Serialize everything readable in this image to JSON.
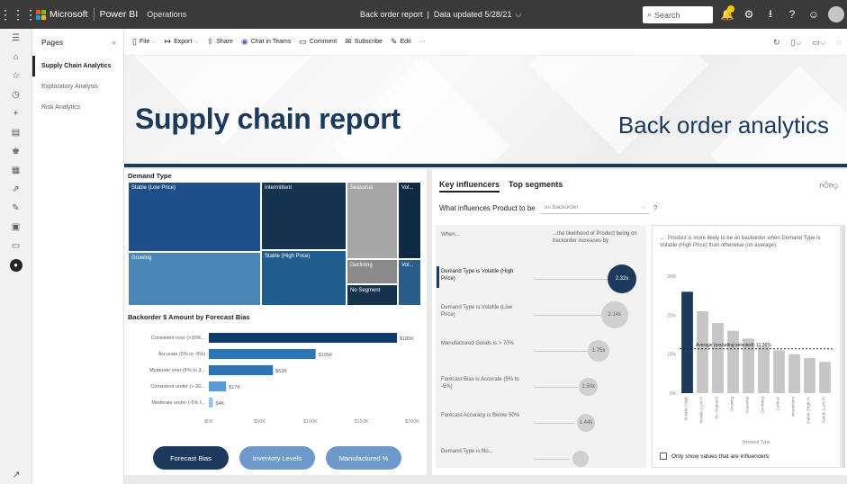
{
  "topbar": {
    "brand_ms": "Microsoft",
    "brand_pbi": "Power BI",
    "workspace": "Operations",
    "report_name": "Back order report",
    "data_updated": "Data updated 5/28/21",
    "search_placeholder": "Search",
    "icons": [
      "waffle-icon",
      "notification-icon",
      "settings-icon",
      "download-icon",
      "help-icon",
      "smiley-icon",
      "avatar"
    ],
    "colors": {
      "bar": "#3b3a39",
      "notification": "#f2c811"
    }
  },
  "rail": {
    "icons": [
      "menu-icon",
      "home-icon",
      "favorites-icon",
      "recent-icon",
      "create-icon",
      "datasets-icon",
      "goals-icon",
      "apps-icon",
      "shared-icon",
      "learn-icon",
      "workspaces-icon",
      "deployment-icon",
      "workspace-active-icon"
    ],
    "expand_glyph": "↗"
  },
  "pages": {
    "header": "Pages",
    "collapse_glyph": "«",
    "items": [
      {
        "label": "Supply Chain Analytics",
        "active": true
      },
      {
        "label": "Exploratory Analysis",
        "active": false
      },
      {
        "label": "Risk Analytics",
        "active": false
      }
    ]
  },
  "commandbar": {
    "items": [
      {
        "label": "File",
        "icon": "file-icon",
        "chevron": true
      },
      {
        "label": "Export",
        "icon": "export-icon",
        "chevron": true
      },
      {
        "label": "Share",
        "icon": "share-icon",
        "chevron": false
      },
      {
        "label": "Chat in Teams",
        "icon": "teams-icon",
        "chevron": false
      },
      {
        "label": "Comment",
        "icon": "comment-icon",
        "chevron": false
      },
      {
        "label": "Subscribe",
        "icon": "subscribe-icon",
        "chevron": false
      },
      {
        "label": "Edit",
        "icon": "edit-icon",
        "chevron": false
      },
      {
        "label": "···",
        "icon": "more-icon",
        "chevron": false
      }
    ],
    "right_icons": [
      "refresh-icon",
      "bookmark-icon",
      "view-icon",
      "reset-icon"
    ]
  },
  "banner": {
    "title": "Supply chain report",
    "subtitle": "Back order analytics",
    "accent": "#1b3a5c"
  },
  "treemap": {
    "title": "Demand Type",
    "tiles": [
      {
        "label": "Stable (Low Price)",
        "color": "#1e4f8a"
      },
      {
        "label": "Growing",
        "color": "#4a86b8"
      },
      {
        "label": "Intermittent",
        "color": "#15324f"
      },
      {
        "label": "Stable (High Price)",
        "color": "#1f5d8f"
      },
      {
        "label": "Seasonal",
        "color": "#a6a6a6"
      },
      {
        "label": "Declining",
        "color": "#8a8a8a"
      },
      {
        "label": "No Segment",
        "color": "#15324f"
      },
      {
        "label": "Vol...",
        "color": "#0f2a45"
      },
      {
        "label": "Vol...",
        "color": "#2b5d8a"
      }
    ]
  },
  "chart_data": {
    "type": "bar",
    "title": "Backorder $ Amount by Forecast Bias",
    "orientation": "horizontal",
    "categories": [
      "Consistent over (>30%...",
      "Accurate (5% to -5%)",
      "Moderate over (5% to 3...",
      "Consistent under (<-30...",
      "Moderate under (-5% t..."
    ],
    "values": [
      185,
      105,
      63,
      17,
      4
    ],
    "data_labels": [
      "$185K",
      "$105K",
      "$63K",
      "$17K",
      "$4K"
    ],
    "x_ticks": [
      "$0K",
      "$50K",
      "$100K",
      "$150K",
      "$200K"
    ],
    "xlim": [
      0,
      200
    ],
    "colors": [
      "#0f3c69",
      "#2e75b6",
      "#2e75b6",
      "#5b9bd5",
      "#9dc3e6"
    ]
  },
  "buttons": [
    {
      "label": "Forecast Bias",
      "color": "#1b3a5c"
    },
    {
      "label": "Inventory Levels",
      "color": "#6d9ac8"
    },
    {
      "label": "Manufactured %",
      "color": "#6d9ac8"
    }
  ],
  "key_influencers": {
    "tabs": [
      "Key influencers",
      "Top segments"
    ],
    "question_prefix": "What influences Product to be",
    "question_value": "on backorder",
    "help_glyph": "?",
    "col_when": "When...",
    "col_likelihood": "...the likelihood of Product being on backorder increases by",
    "rows": [
      {
        "label": "Demand Type is Volatile (High Price)",
        "value": "2.32x",
        "factor": 2.32,
        "selected": true
      },
      {
        "label": "Demand Type is Volatile (Low Price)",
        "value": "2.14x",
        "factor": 2.14,
        "selected": false
      },
      {
        "label": "Manufactured Goods is > 70%",
        "value": "1.75x",
        "factor": 1.75,
        "selected": false
      },
      {
        "label": "Forecast Bias is Accurate (5% to -5%)",
        "value": "1.50x",
        "factor": 1.5,
        "selected": false
      },
      {
        "label": "Forecast Accuracy is Below 50%",
        "value": "1.44x",
        "factor": 1.44,
        "selected": false
      },
      {
        "label": "Demand Type is No...",
        "value": "",
        "factor": 1.3,
        "selected": false
      }
    ],
    "detail_text": "Product is more likely to be on backorder when Demand Type is Volatile (High Price) than otherwise (on average).",
    "only_show": "Only show values that are influencers",
    "feedback_icons": [
      "thumbs-up-icon",
      "thumbs-down-icon"
    ]
  },
  "detail_chart": {
    "type": "bar",
    "y_ticks": [
      "0%",
      "10%",
      "20%",
      "30%"
    ],
    "ylim": [
      0,
      30
    ],
    "average_label": "Average (excluding selected): 11.36%",
    "average": 11.36,
    "categories": [
      "Volatile (High",
      "Volatile (Low P",
      "No Segment",
      "Growing",
      "Seasonal",
      "Declining",
      "Cyclical",
      "Intermittent",
      "Stable (High Pr",
      "Stable (Low Pr"
    ],
    "values": [
      26,
      21,
      18,
      16,
      14,
      12,
      11,
      10,
      9,
      8
    ],
    "selected_color": "#1b3a5c",
    "other_color": "#c8c6c4",
    "xlabel": "Demand Type"
  }
}
